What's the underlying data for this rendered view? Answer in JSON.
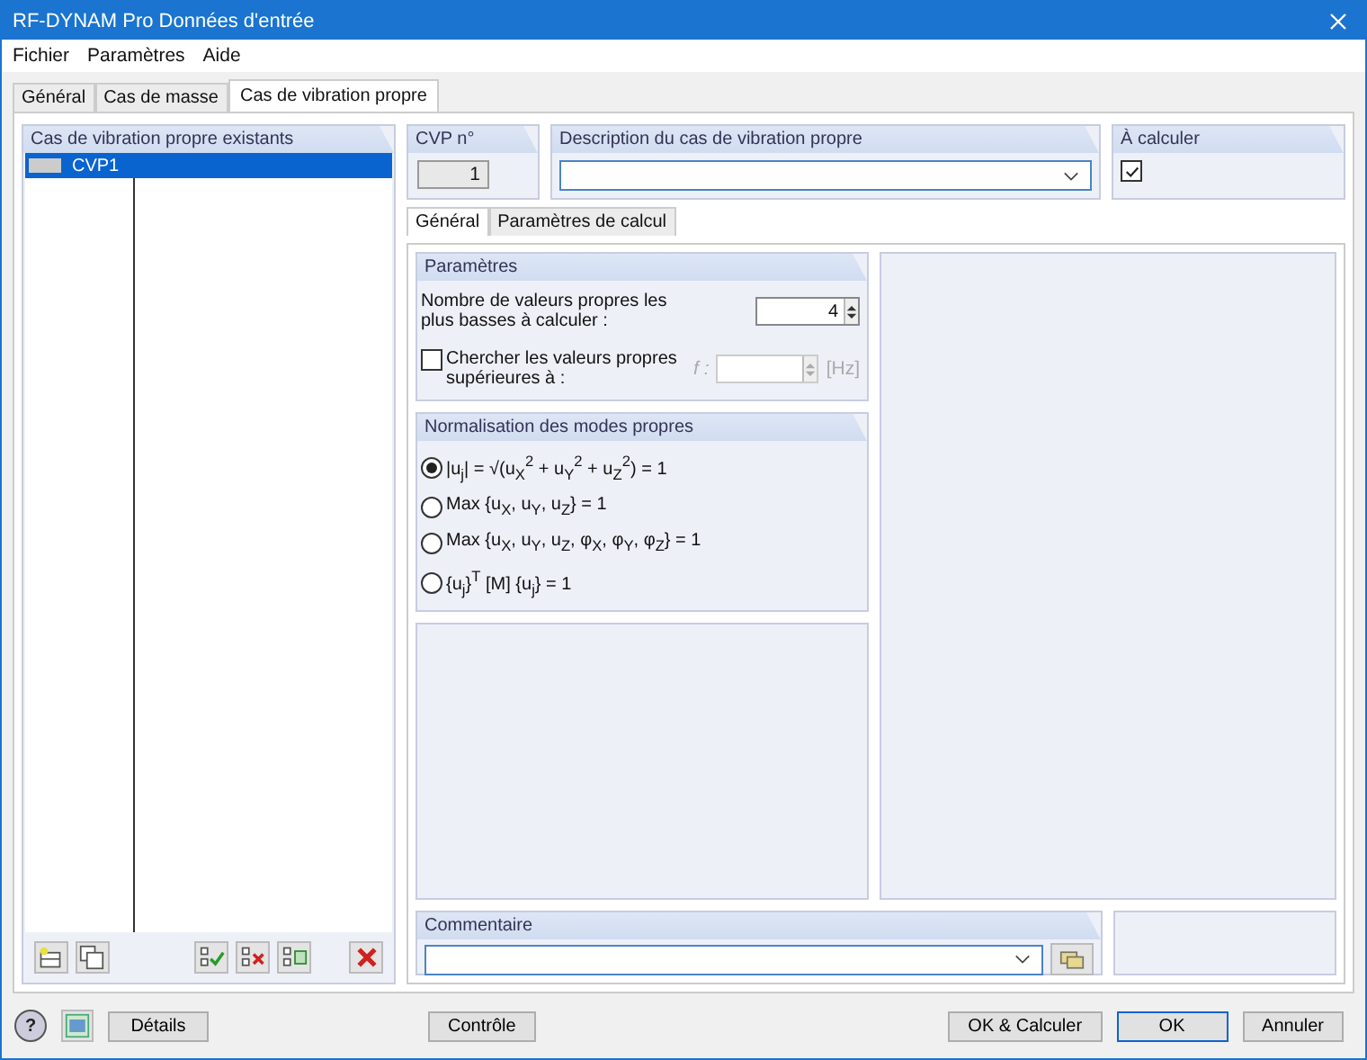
{
  "window": {
    "title": "RF-DYNAM Pro Données d'entrée"
  },
  "menu": [
    "Fichier",
    "Paramètres",
    "Aide"
  ],
  "tabs": [
    {
      "label": "Général",
      "selected": false
    },
    {
      "label": "Cas de masse",
      "selected": false
    },
    {
      "label": "Cas de vibration propre",
      "selected": true
    }
  ],
  "case_list": {
    "title": "Cas de vibration propre existants",
    "items": [
      {
        "label": "CVP1",
        "selected": true
      }
    ]
  },
  "cvp_number": {
    "title": "CVP n°",
    "value": "1"
  },
  "description": {
    "title": "Description du cas de vibration propre"
  },
  "to_calculate": {
    "title": "À calculer",
    "checked": true
  },
  "subtabs": [
    {
      "label": "Général",
      "selected": true
    },
    {
      "label": "Paramètres de calcul",
      "selected": false
    }
  ],
  "parameters": {
    "title": "Paramètres",
    "lowest_label": "Nombre de valeurs propres les plus basses à calculer :",
    "lowest_value": "4",
    "higher": {
      "label": "Chercher les valeurs propres supérieures à :",
      "checked": false,
      "field_label": "f :",
      "unit": "[Hz]",
      "disabled": true
    }
  },
  "normalization": {
    "title": "Normalisation des modes propres",
    "options": [
      {
        "label": "|u$_{j}$| = √(u$_{X}$$^{2}$ + u$_{Y}$$^{2}$ + u$_{Z}$$^{2}$) = 1",
        "selected": true
      },
      {
        "label": "Max {u$_{X}$, u$_{Y}$, u$_{Z}$} = 1",
        "selected": false
      },
      {
        "label": "Max {u$_{X}$, u$_{Y}$, u$_{Z}$, φ$_{X}$, φ$_{Y}$, φ$_{Z}$} = 1",
        "selected": false
      },
      {
        "label": "{u$_{j}$}$^{T}$ [M] {u$_{j}$} = 1",
        "selected": false
      }
    ]
  },
  "comment": {
    "title": "Commentaire"
  },
  "footer": {
    "help": "?",
    "details": "Détails",
    "control": "Contrôle",
    "buttons": [
      {
        "label": "OK & Calculer",
        "selected": false
      },
      {
        "label": "OK",
        "selected": true
      },
      {
        "label": "Annuler",
        "selected": false
      }
    ]
  }
}
